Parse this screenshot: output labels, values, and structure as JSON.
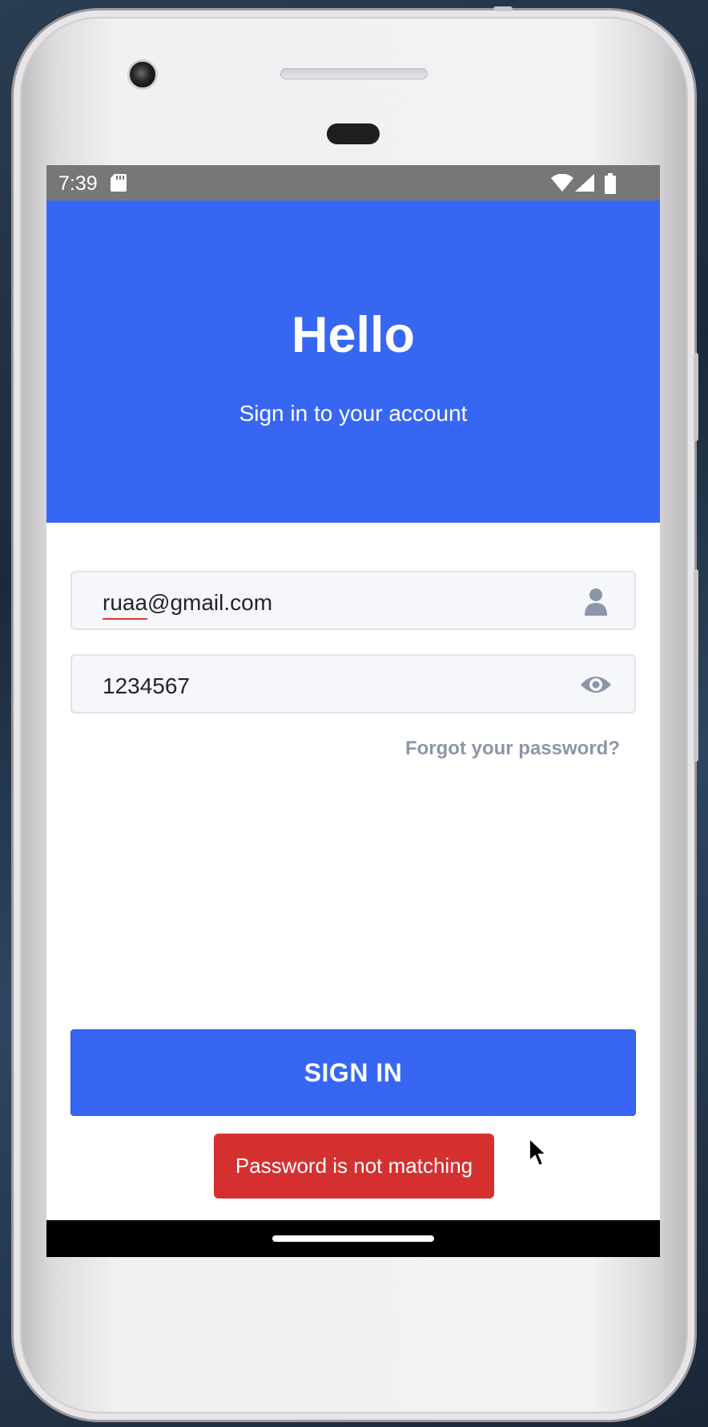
{
  "status_bar": {
    "time": "7:39",
    "icons": [
      "sd-card-icon",
      "wifi-icon",
      "signal-icon",
      "battery-icon"
    ]
  },
  "header": {
    "title": "Hello",
    "subtitle": "Sign in to your account"
  },
  "form": {
    "email_value": "ruaa@gmail.com",
    "email_icon": "person-icon",
    "password_value": "1234567",
    "password_icon": "eye-icon",
    "forgot_link": "Forgot your password?"
  },
  "signin_button": "SIGN IN",
  "toast": "Password is not matching",
  "colors": {
    "primary": "#3767f2",
    "toast_bg": "#d53030",
    "link": "#8d96a8",
    "status_bar": "#777777"
  }
}
